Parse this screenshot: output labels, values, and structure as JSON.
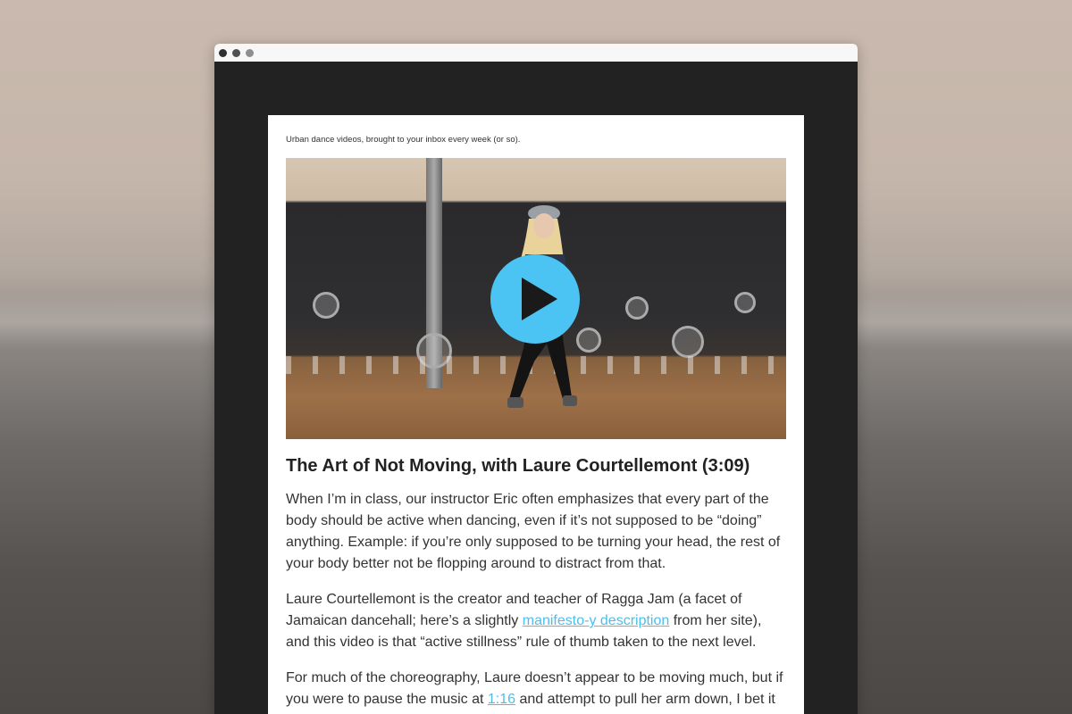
{
  "window": {
    "controls": [
      "close",
      "minimize",
      "zoom"
    ]
  },
  "email": {
    "tagline": "Urban dance videos, brought to your inbox every week (or so).",
    "video": {
      "play_icon": "play-icon",
      "accent_color": "#4bc3f3"
    },
    "title": "The Art of Not Moving, with Laure Courtellemont (3:09)",
    "paragraph1": "When I’m in class, our instructor Eric often emphasizes that every part of the body should be active when dancing, even if it’s not supposed to be “doing” anything. Example: if you’re only supposed to be turning your head, the rest of your body better not be flopping around to distract from that.",
    "paragraph2": {
      "before_link": "Laure Courtellemont is the creator and teacher of Ragga Jam (a facet of Jamaican dancehall; here’s a slightly ",
      "link_text": "manifesto-y description",
      "after_link": " from her site), and this video is that “active stillness” rule of thumb taken to the next level."
    },
    "paragraph3": {
      "before_link": "For much of the choreography, Laure doesn’t appear to be moving much, but if you were to pause the music at ",
      "link_text": "1:16",
      "after_link": " and attempt to pull her arm down, I bet it"
    }
  }
}
